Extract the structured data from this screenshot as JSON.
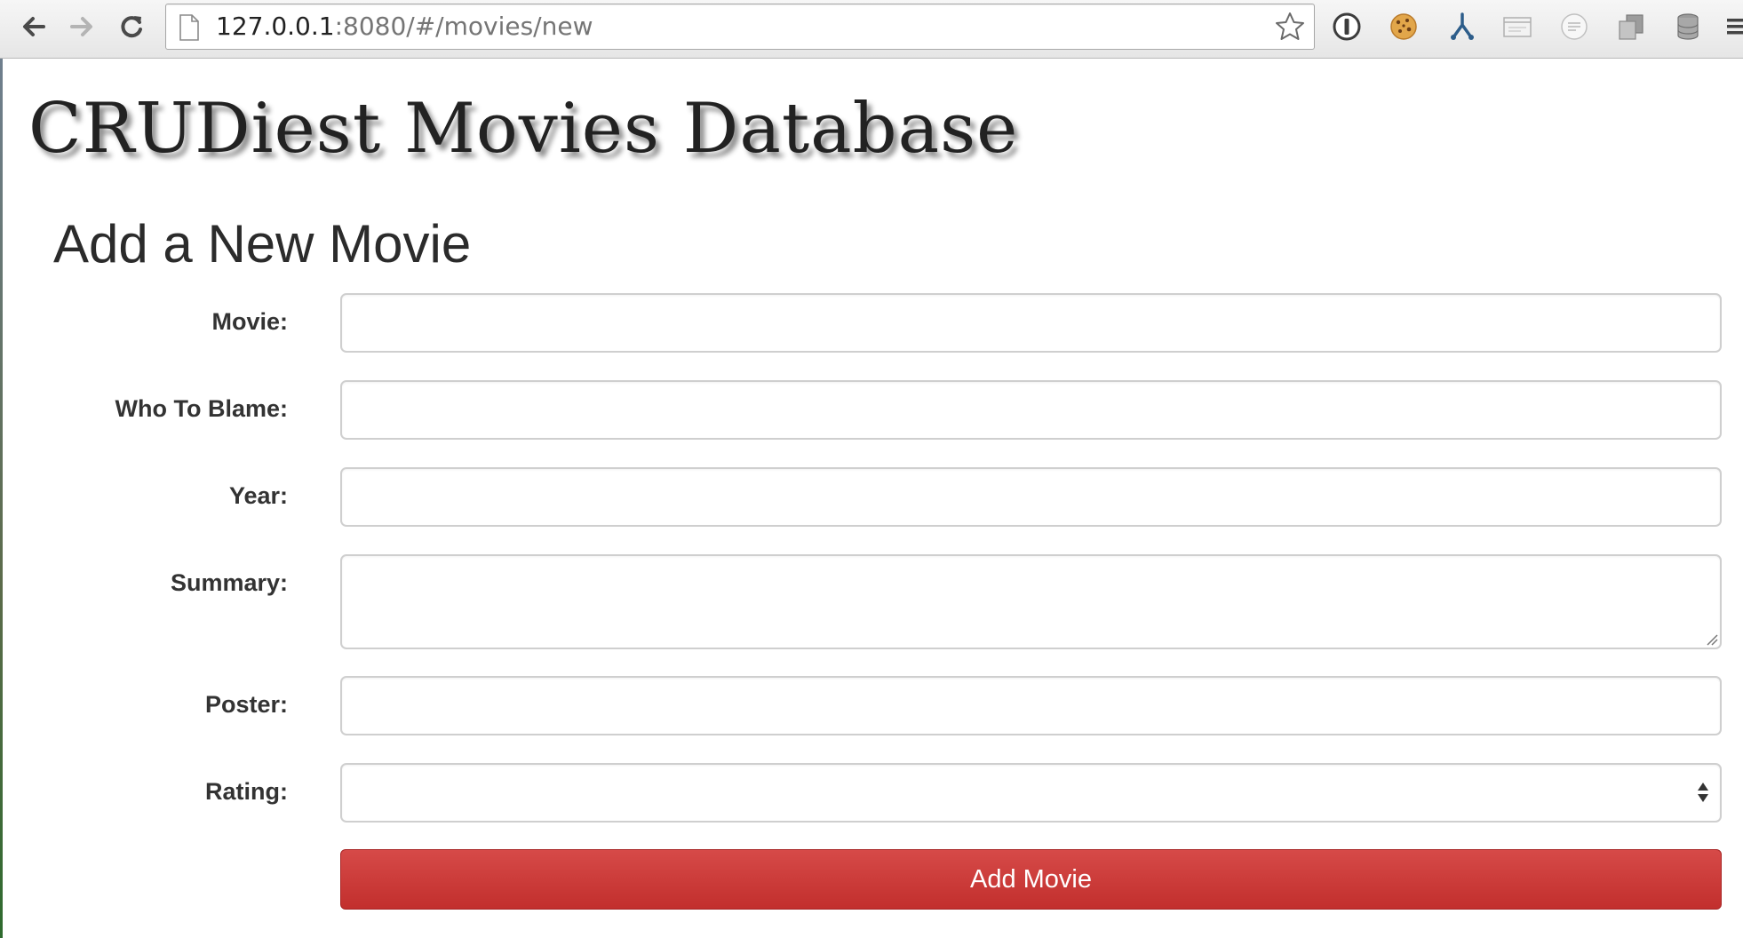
{
  "browser": {
    "url_host": "127.0.0.1",
    "url_rest": ":8080/#/movies/new"
  },
  "page": {
    "site_title": "CRUDiest Movies Database",
    "form_title": "Add a New Movie"
  },
  "form": {
    "fields": [
      {
        "label": "Movie:",
        "value": ""
      },
      {
        "label": "Who To Blame:",
        "value": ""
      },
      {
        "label": "Year:",
        "value": ""
      },
      {
        "label": "Summary:",
        "value": ""
      },
      {
        "label": "Poster:",
        "value": ""
      },
      {
        "label": "Rating:",
        "value": ""
      }
    ],
    "submit_label": "Add Movie"
  },
  "colors": {
    "button_red": "#c9383a",
    "field_border": "#cfcfcf"
  }
}
